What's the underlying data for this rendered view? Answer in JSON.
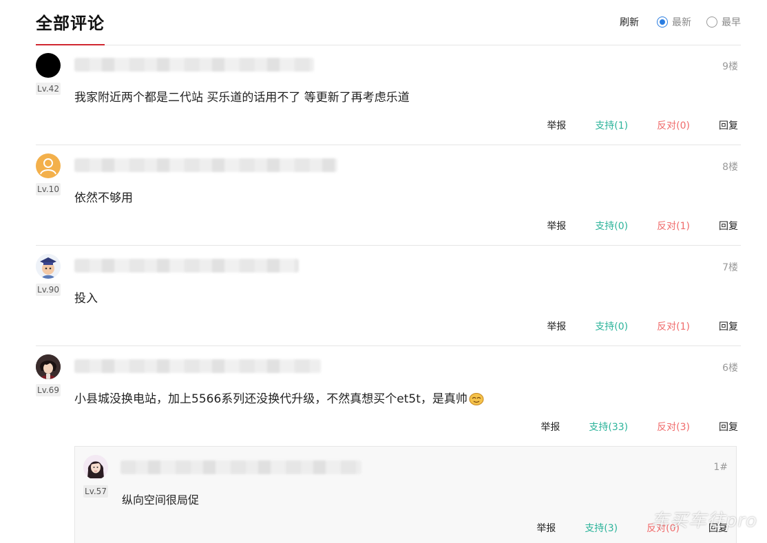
{
  "header": {
    "title": "全部评论",
    "refresh_label": "刷新",
    "sort_options": [
      {
        "label": "最新",
        "selected": true
      },
      {
        "label": "最早",
        "selected": false
      }
    ]
  },
  "actions": {
    "report": "举报",
    "reply": "回复"
  },
  "comments": [
    {
      "level": "Lv.42",
      "floor": "9楼",
      "text": "我家附近两个都是二代站 买乐道的话用不了 等更新了再考虑乐道",
      "support": "支持(1)",
      "oppose": "反对(0)",
      "avatar": "black-circle"
    },
    {
      "level": "Lv.10",
      "floor": "8楼",
      "text": "依然不够用",
      "support": "支持(0)",
      "oppose": "反对(1)",
      "avatar": "default-user-orange"
    },
    {
      "level": "Lv.90",
      "floor": "7楼",
      "text": "投入",
      "support": "支持(0)",
      "oppose": "反对(1)",
      "avatar": "cartoon-student"
    },
    {
      "level": "Lv.69",
      "floor": "6楼",
      "text": "小县城没换电站，加上5566系列还没换代升级，不然真想买个et5t，是真帅",
      "support": "支持(33)",
      "oppose": "反对(3)",
      "avatar": "anime-character"
    }
  ],
  "reply": {
    "level": "Lv.57",
    "floor": "1#",
    "text": "纵向空间很局促",
    "support": "支持(3)",
    "oppose": "反对(0)",
    "avatar": "girl-photo"
  },
  "watermark": "车买车往pro",
  "colors": {
    "accent_red": "#d0262f",
    "support_green": "#2bb39a",
    "oppose_red": "#f06b6b",
    "radio_blue": "#2a7de1"
  }
}
